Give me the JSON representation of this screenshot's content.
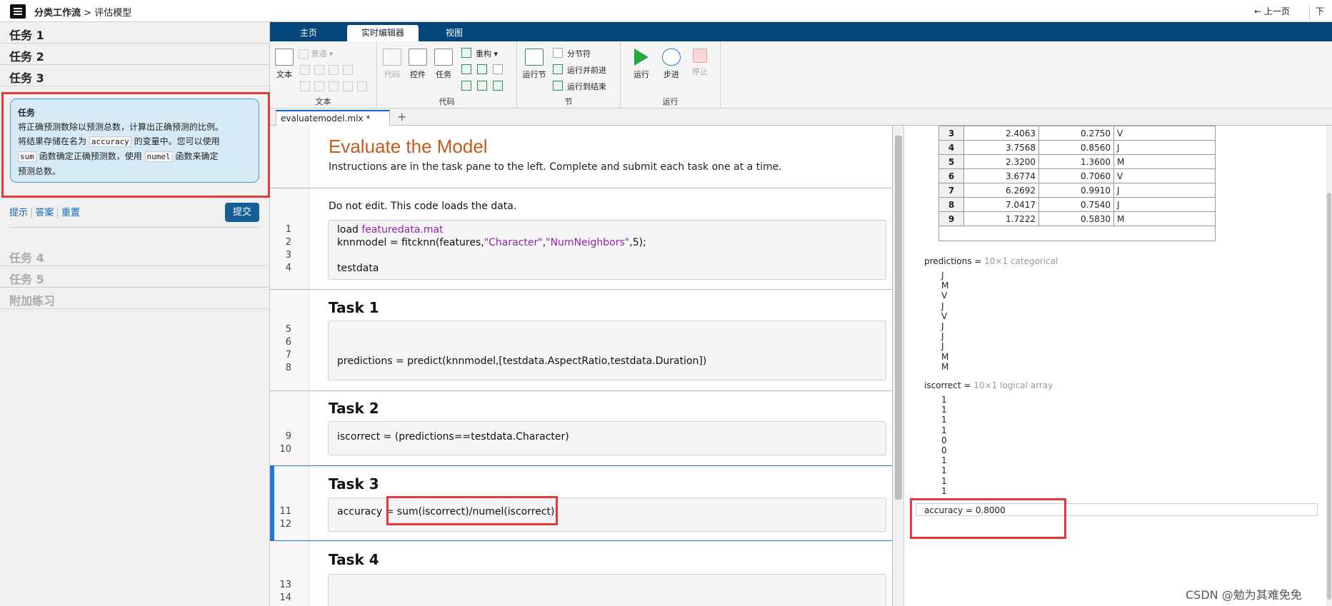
{
  "app": {
    "breadcrumb_root": "分类工作流",
    "breadcrumb_sep": ">",
    "breadcrumb_page": "评估模型",
    "nav_prev": "← 上一页",
    "nav_next": "下一节"
  },
  "taskpane": {
    "tasks_before": [
      "任务 1",
      "任务 2",
      "任务 3"
    ],
    "current": {
      "heading": "任务",
      "line1": "将正确预测数除以预测总数，计算出正确预测的比例。",
      "line2a": "将结果存储在名为 ",
      "var": "accuracy",
      "line2b": " 的变量中。您可以使用",
      "fn1": "sum",
      "line3a": " 函数确定正确预测数，使用 ",
      "fn2": "numel",
      "line3b": " 函数来确定",
      "line4": "预测总数。"
    },
    "links": [
      "提示",
      "答案",
      "重置"
    ],
    "submit": "提交",
    "tasks_after": [
      "任务 4",
      "任务 5",
      "附加练习"
    ]
  },
  "ribbon": {
    "tabs": [
      "主页",
      "实时编辑器",
      "视图"
    ],
    "active_tab": 1,
    "text_section": {
      "label": "文本",
      "text_button": "文本",
      "style_select": "普通"
    },
    "code_section": {
      "label": "代码",
      "code_button": "代码",
      "controls_button": "控件",
      "task_button": "任务",
      "refactor": "重构"
    },
    "section_section": {
      "label": "节",
      "section_break": "分节符",
      "run_section": "运行节",
      "run_and_advance": "运行并前进",
      "run_to_end": "运行到结束"
    },
    "run_section": {
      "label": "运行",
      "run": "运行",
      "step": "步进",
      "stop": "停止"
    }
  },
  "file_tab": {
    "name": "evaluatemodel.mlx *",
    "add": "+"
  },
  "editor": {
    "title": "Evaluate the Model",
    "subtitle": "Instructions are in the task pane to the left. Complete and submit each task one at a time.",
    "note": "Do not edit. This code loads the data.",
    "line1a": "load ",
    "line1b": "featuredata.mat",
    "line2a": "knnmodel = fitcknn(features,",
    "line2b": "\"Character\"",
    "line2c": ",",
    "line2d": "\"NumNeighbors\"",
    "line2e": ",5);",
    "line4": "testdata",
    "task1": "Task 1",
    "task1_code": "predictions = predict(knnmodel,[testdata.AspectRatio,testdata.Duration])",
    "task2": "Task 2",
    "task2_code": "iscorrect = (predictions==testdata.Character)",
    "task3": "Task 3",
    "task3_code_a": "accuracy = ",
    "task3_code_b": "sum(iscorrect)/numel(iscorrect)",
    "task4": "Task 4",
    "line_numbers": [
      "1",
      "2",
      "3",
      "4",
      "5",
      "6",
      "7",
      "8",
      "9",
      "10",
      "11",
      "12",
      "13",
      "14"
    ]
  },
  "output": {
    "table_rows": [
      [
        "3",
        "2.4063",
        "0.2750",
        "V"
      ],
      [
        "4",
        "3.7568",
        "0.8560",
        "J"
      ],
      [
        "5",
        "2.3200",
        "1.3600",
        "M"
      ],
      [
        "6",
        "3.6774",
        "0.7060",
        "V"
      ],
      [
        "7",
        "6.2692",
        "0.9910",
        "J"
      ],
      [
        "8",
        "7.0417",
        "0.7540",
        "J"
      ],
      [
        "9",
        "1.7222",
        "0.5830",
        "M"
      ]
    ],
    "predictions_label": "predictions = ",
    "predictions_type": "10×1 categorical",
    "predictions_values": [
      "J",
      "M",
      "V",
      "J",
      "V",
      "J",
      "J",
      "J",
      "M",
      "M"
    ],
    "iscorrect_label": "iscorrect = ",
    "iscorrect_type": "10×1 logical array",
    "iscorrect_values": [
      "1",
      "1",
      "1",
      "1",
      "0",
      "0",
      "1",
      "1",
      "1",
      "1"
    ],
    "accuracy": "accuracy = 0.8000"
  },
  "watermark": "CSDN @勉为其难免免",
  "colors": {
    "ribbon_tab_bar": "#05477a",
    "accent_red": "#e53935",
    "title_orange": "#c65a1e",
    "string_purple": "#8e24aa",
    "submit_blue": "#155e96"
  }
}
